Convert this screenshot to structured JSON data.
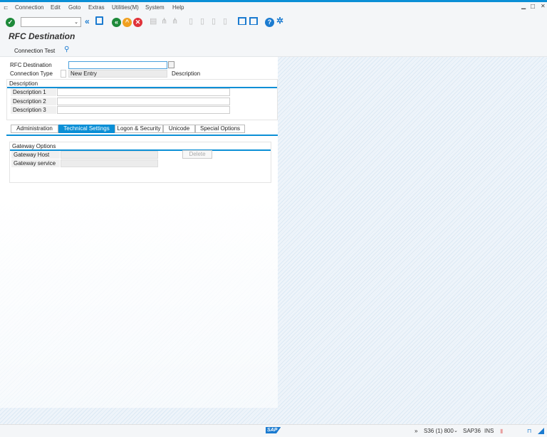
{
  "menu": {
    "items": [
      "Connection",
      "Edit",
      "Goto",
      "Extras",
      "Utilities(M)",
      "System",
      "Help"
    ]
  },
  "window_controls": {
    "minimize": "▁",
    "maximize": "□",
    "close": "✕"
  },
  "toolbar": {
    "command_field": "",
    "icons": [
      "enter-icon",
      "back-icon",
      "save-icon",
      "back-green-icon",
      "exit-icon",
      "cancel-icon",
      "print-icon",
      "find-icon",
      "find-next-icon",
      "first-page-icon",
      "prev-page-icon",
      "next-page-icon",
      "last-page-icon",
      "new-session-icon",
      "shortcut-icon",
      "help-icon",
      "settings-icon"
    ]
  },
  "title": "RFC Destination",
  "app_toolbar": {
    "connection_test": "Connection Test"
  },
  "form": {
    "rfc_destination_label": "RFC Destination",
    "rfc_destination_value": "",
    "connection_type_label": "Connection Type",
    "connection_type_value": "New Entry",
    "connection_type_desc": "Description",
    "description_group": "Description",
    "descriptions": [
      {
        "label": "Description 1",
        "value": ""
      },
      {
        "label": "Description 2",
        "value": ""
      },
      {
        "label": "Description 3",
        "value": ""
      }
    ]
  },
  "tabs": [
    {
      "label": "Administration"
    },
    {
      "label": "Technical Settings",
      "active": true
    },
    {
      "label": "Logon & Security"
    },
    {
      "label": "Unicode"
    },
    {
      "label": "Special Options"
    }
  ],
  "gateway": {
    "title": "Gateway Options",
    "host_label": "Gateway Host",
    "host_value": "",
    "service_label": "Gateway service",
    "service_value": "",
    "delete": "Delete"
  },
  "status": {
    "logo": "SAP",
    "expand": "»",
    "system": "S36 (1) 800",
    "server": "SAP36",
    "mode": "INS"
  },
  "colors": {
    "accent": "#0a8fd6",
    "background": "#eef4fa"
  }
}
